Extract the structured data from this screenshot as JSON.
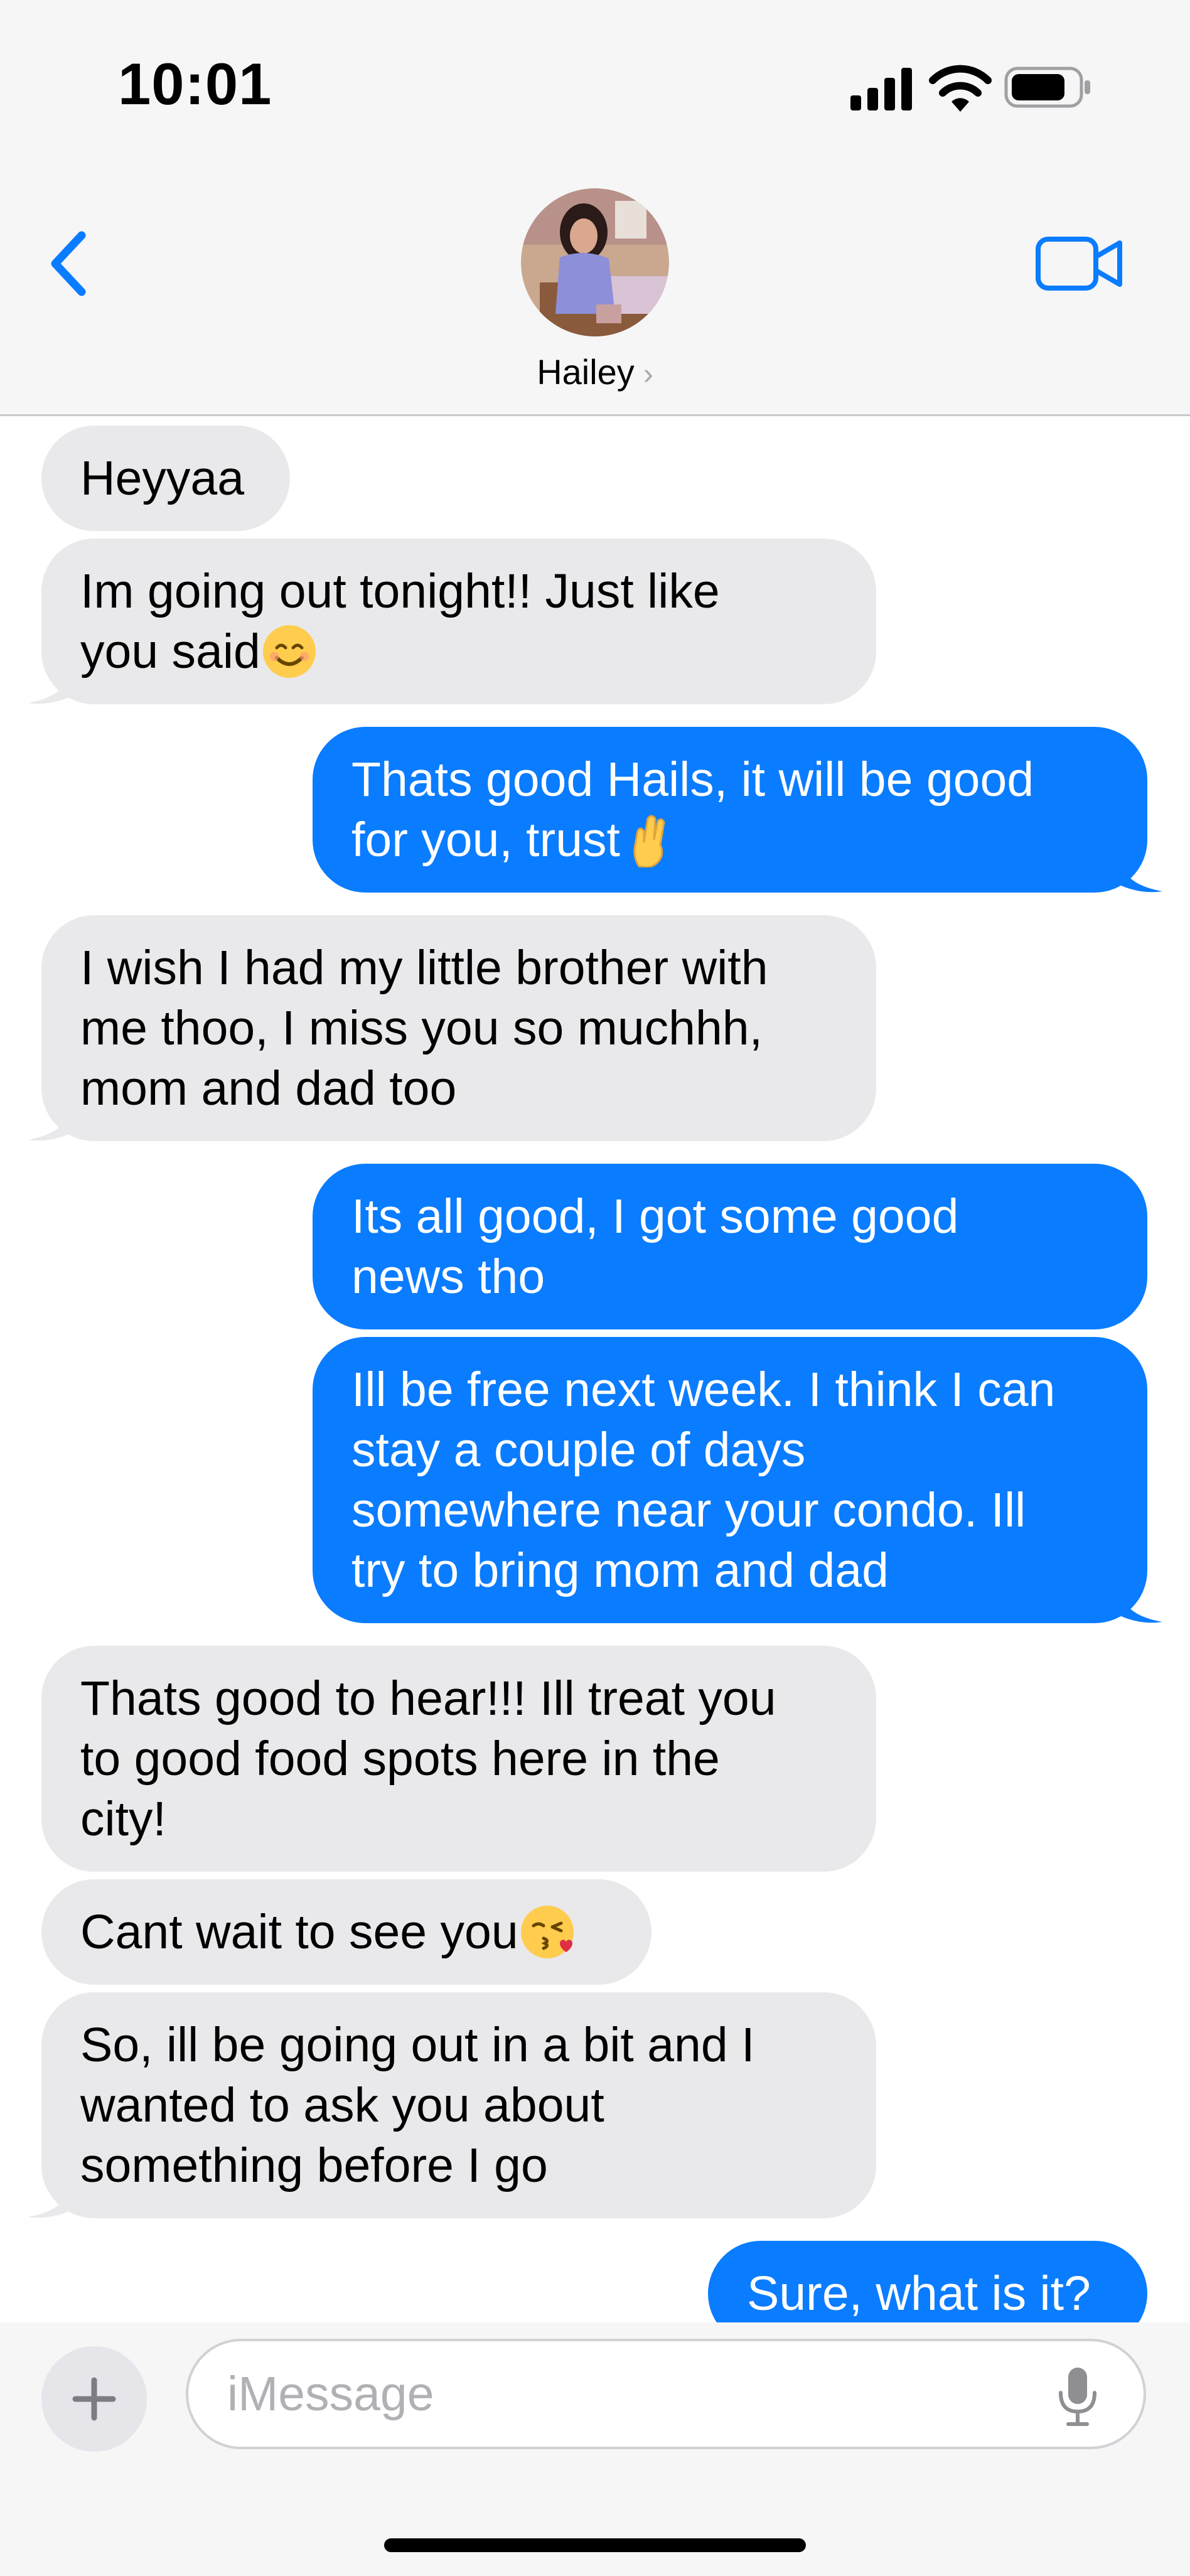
{
  "status_bar": {
    "time": "10:01"
  },
  "header": {
    "contact_name": "Hailey",
    "chevron": "›",
    "icons": [
      "back-icon",
      "avatar",
      "video-call-icon"
    ]
  },
  "messages": [
    {
      "sender": "them",
      "lines": [
        "Heyyaa"
      ]
    },
    {
      "sender": "them",
      "lines": [
        "Im going out tonight!! Just like",
        "you said"
      ],
      "emoji": "smiling-face-emoji"
    },
    {
      "sender": "me",
      "lines": [
        "Thats good Hails, it will be good",
        "for you, trust"
      ],
      "emoji": "crossed-fingers-emoji"
    },
    {
      "sender": "them",
      "lines": [
        "I wish I had my little brother with",
        "me thoo, I miss you so muchhh,",
        "mom and dad too"
      ]
    },
    {
      "sender": "me",
      "lines": [
        "Its all good, I got some good",
        "news tho"
      ]
    },
    {
      "sender": "me",
      "lines": [
        "Ill be free next week. I think I can",
        "stay a couple of days",
        "somewhere near your condo. Ill",
        "try to bring mom and dad"
      ]
    },
    {
      "sender": "them",
      "lines": [
        "Thats good to hear!!! Ill treat you",
        "to good food spots here in the",
        "city!"
      ]
    },
    {
      "sender": "them",
      "lines": [
        "Cant wait to see you"
      ],
      "emoji": "kissing-face-emoji"
    },
    {
      "sender": "them",
      "lines": [
        "So, ill be going out in a bit and I",
        "wanted to ask you about",
        "something before I go"
      ]
    },
    {
      "sender": "me",
      "lines": [
        "Sure, what is it?"
      ]
    }
  ],
  "composer": {
    "placeholder": "iMessage",
    "plus_label": "+"
  },
  "colors": {
    "outgoing": "#0a7cff",
    "incoming": "#e9e9eb",
    "accent": "#0a7cff"
  }
}
